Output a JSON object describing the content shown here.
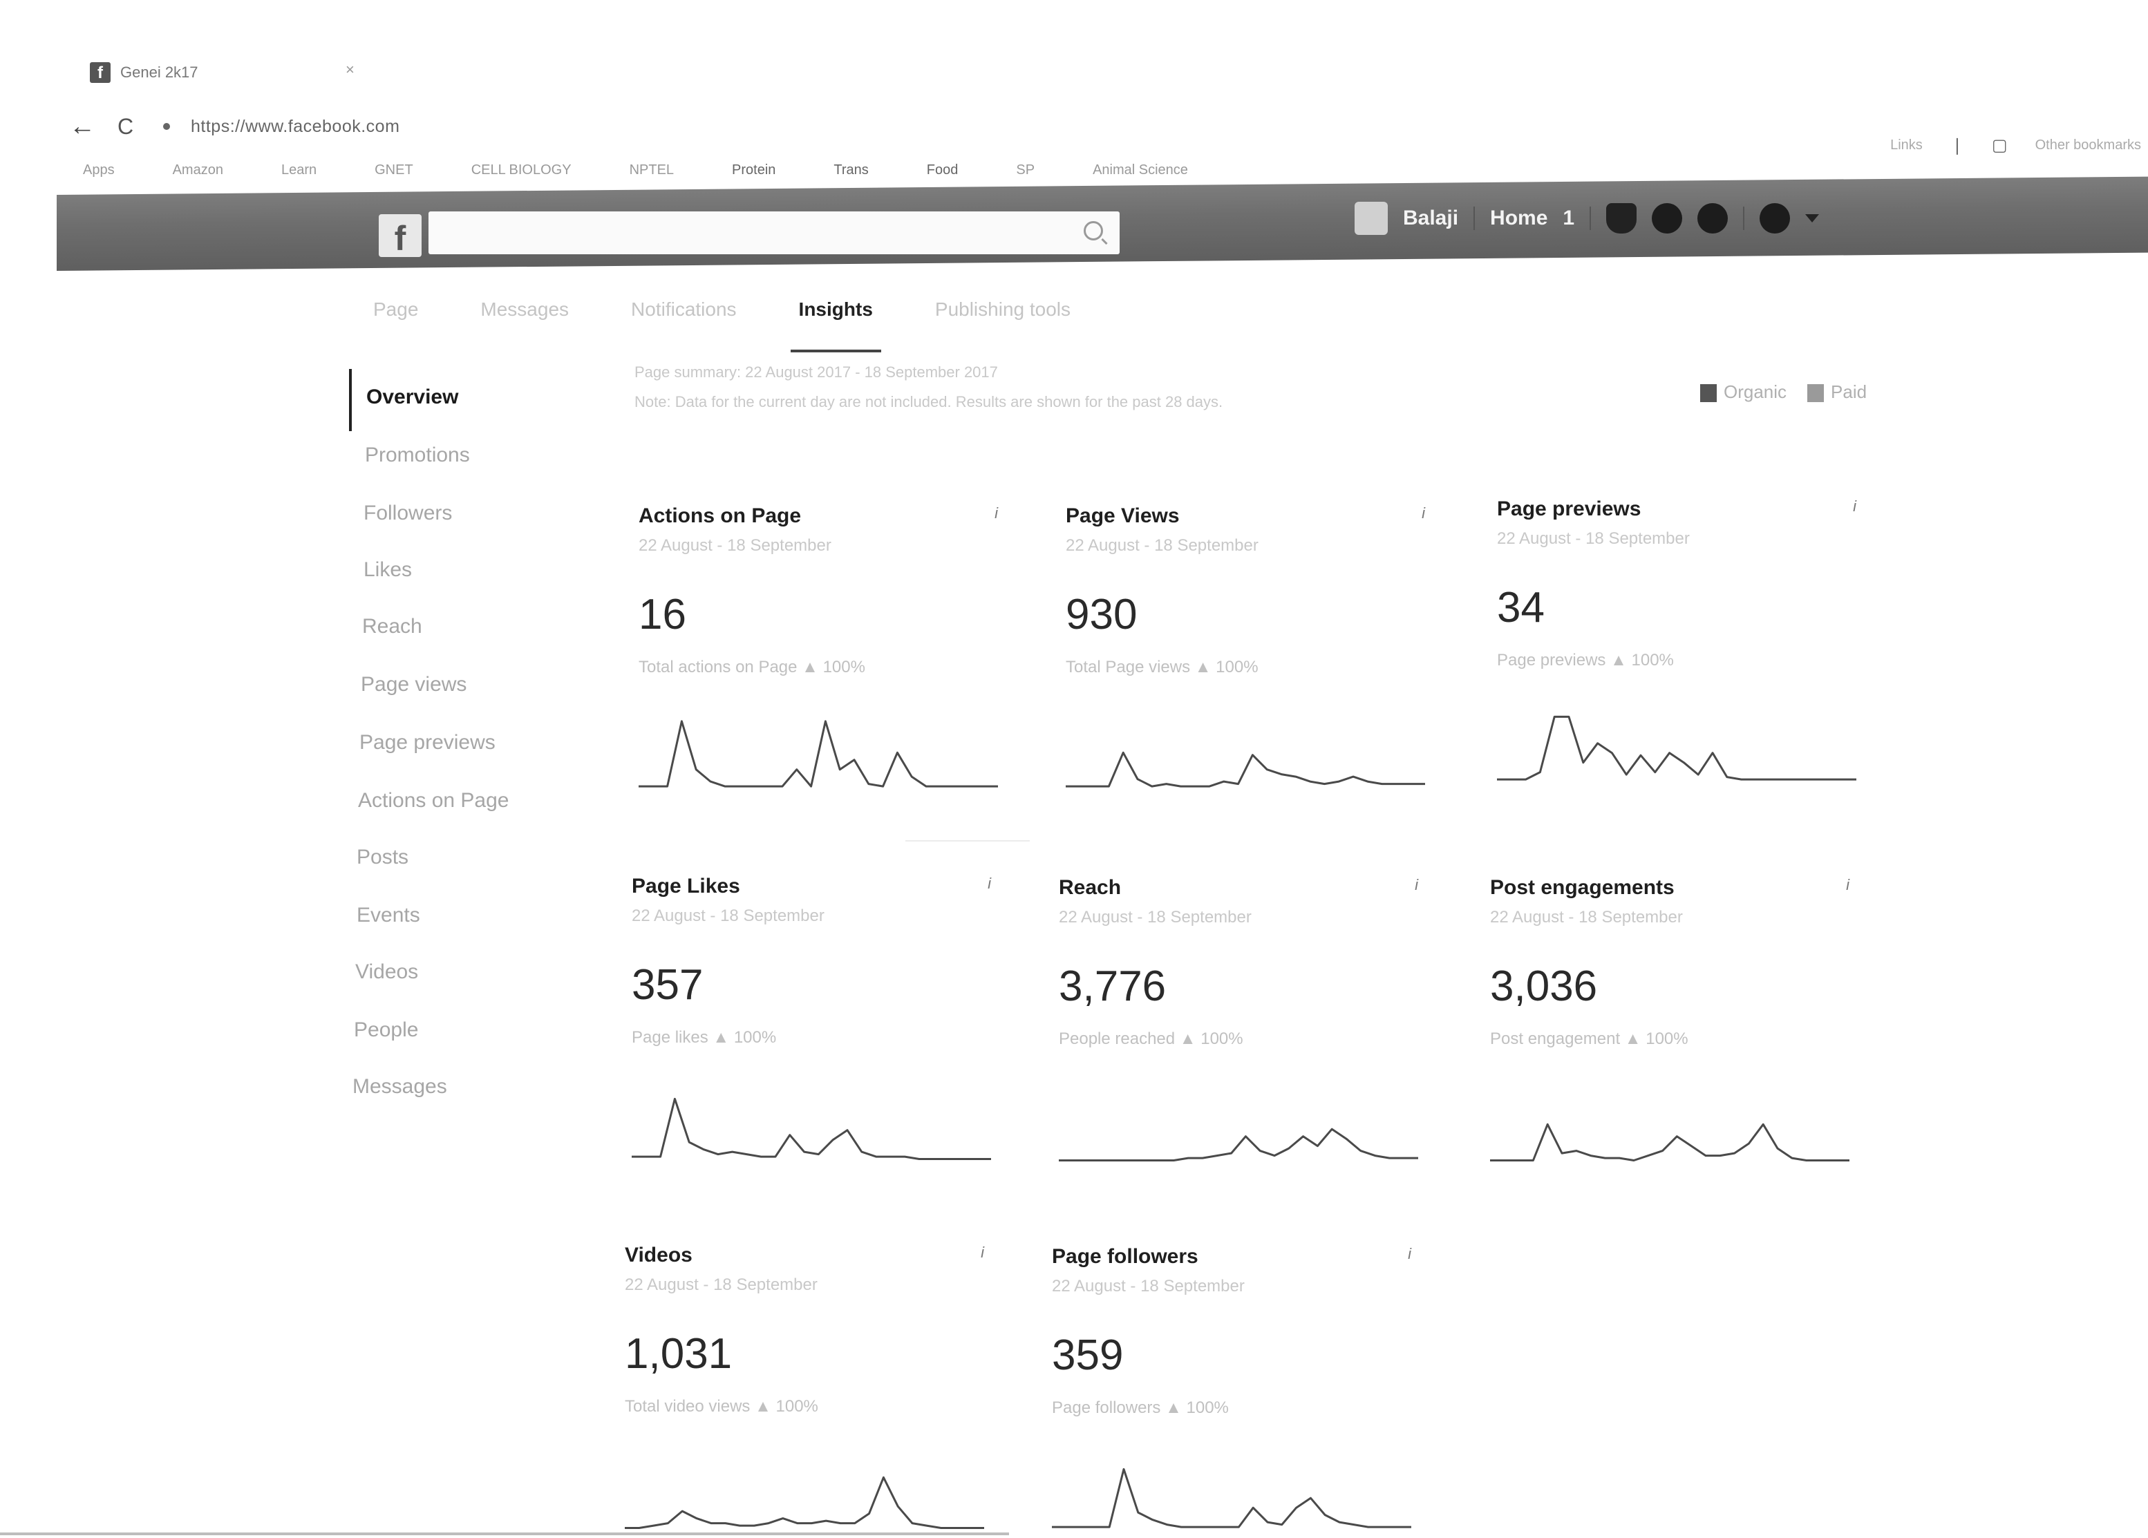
{
  "browser": {
    "tab_title": "Genei 2k17",
    "tab_close": "×",
    "back_arrow": "←",
    "reload_icon": "C",
    "url": "https://www.facebook.com",
    "bookmarks": [
      "Apps",
      "Amazon",
      "Learn",
      "GNET",
      "CELL BIOLOGY",
      "NPTEL",
      "Protein",
      "Trans",
      "Food",
      "SP",
      "Animal Science"
    ],
    "bookmarks_right": [
      "Links",
      "Other bookmarks"
    ]
  },
  "facebook_bar": {
    "logo": "f",
    "search_placeholder": "",
    "user_name": "Balaji",
    "home_label": "Home",
    "home_count": "1"
  },
  "page_tabs": [
    {
      "label": "Page"
    },
    {
      "label": "Messages"
    },
    {
      "label": "Notifications"
    },
    {
      "label": "Insights",
      "active": true
    },
    {
      "label": "Publishing tools"
    }
  ],
  "sidebar": [
    {
      "label": "Overview",
      "active": true
    },
    {
      "label": "Promotions"
    },
    {
      "label": "Followers"
    },
    {
      "label": "Likes"
    },
    {
      "label": "Reach"
    },
    {
      "label": "Page views"
    },
    {
      "label": "Page previews"
    },
    {
      "label": "Actions on Page"
    },
    {
      "label": "Posts"
    },
    {
      "label": "Events"
    },
    {
      "label": "Videos"
    },
    {
      "label": "People"
    },
    {
      "label": "Messages"
    }
  ],
  "header": {
    "date_line": "Page summary: 22 August 2017 - 18 September 2017",
    "description": "Note: Data for the current day are not included. Results are shown for the past 28 days.",
    "legend": [
      {
        "label": "Organic",
        "color": "#555555"
      },
      {
        "label": "Paid",
        "color": "#9a9a9a"
      }
    ]
  },
  "cards": [
    {
      "title": "Actions on Page",
      "range": "22 August - 18 September",
      "value": "16",
      "caption": "Total actions on Page ▲ 100%",
      "info": "i",
      "spark": [
        8,
        8,
        8,
        62,
        22,
        12,
        8,
        8,
        8,
        8,
        8,
        22,
        8,
        62,
        22,
        30,
        10,
        8,
        36,
        16,
        8,
        8,
        8,
        8,
        8,
        8
      ]
    },
    {
      "title": "Page Views",
      "range": "22 August - 18 September",
      "value": "930",
      "caption": "Total Page views ▲ 100%",
      "info": "i",
      "spark": [
        8,
        8,
        8,
        8,
        36,
        14,
        8,
        10,
        8,
        8,
        8,
        12,
        10,
        34,
        22,
        18,
        16,
        12,
        10,
        12,
        16,
        12,
        10,
        10,
        10,
        10
      ]
    },
    {
      "title": "Page previews",
      "range": "22 August - 18 September",
      "value": "34",
      "caption": "Page previews ▲ 100%",
      "info": "i",
      "spark": [
        8,
        8,
        8,
        14,
        60,
        60,
        22,
        38,
        30,
        12,
        28,
        14,
        30,
        22,
        12,
        30,
        10,
        8,
        8,
        8,
        8,
        8,
        8,
        8,
        8,
        8
      ]
    },
    {
      "title": "Page Likes",
      "range": "22 August - 18 September",
      "value": "357",
      "caption": "Page likes ▲ 100%",
      "info": "i",
      "spark": [
        8,
        8,
        8,
        56,
        20,
        14,
        10,
        12,
        10,
        8,
        8,
        26,
        12,
        10,
        22,
        30,
        12,
        8,
        8,
        8,
        6,
        6,
        6,
        6,
        6,
        6
      ]
    },
    {
      "title": "Reach",
      "range": "22 August - 18 September",
      "value": "3,776",
      "caption": "People reached ▲ 100%",
      "info": "i",
      "spark": [
        6,
        6,
        6,
        6,
        6,
        6,
        6,
        6,
        6,
        8,
        8,
        10,
        12,
        26,
        14,
        10,
        16,
        26,
        18,
        32,
        24,
        14,
        10,
        8,
        8,
        8
      ]
    },
    {
      "title": "Post engagements",
      "range": "22 August - 18 September",
      "value": "3,036",
      "caption": "Post engagement ▲ 100%",
      "info": "i",
      "spark": [
        6,
        6,
        6,
        6,
        36,
        12,
        14,
        10,
        8,
        8,
        6,
        10,
        14,
        26,
        18,
        10,
        10,
        12,
        20,
        36,
        16,
        8,
        6,
        6,
        6,
        6
      ]
    },
    {
      "title": "Videos",
      "range": "22 August - 18 September",
      "value": "1,031",
      "caption": "Total video views ▲ 100%",
      "info": "i",
      "spark": [
        6,
        6,
        8,
        10,
        20,
        14,
        10,
        10,
        8,
        8,
        10,
        14,
        10,
        10,
        12,
        10,
        10,
        18,
        48,
        24,
        10,
        8,
        6,
        6,
        6,
        6
      ]
    },
    {
      "title": "Page followers",
      "range": "22 August - 18 September",
      "value": "359",
      "caption": "Page followers ▲ 100%",
      "info": "i",
      "spark": [
        8,
        8,
        8,
        8,
        8,
        56,
        20,
        14,
        10,
        8,
        8,
        8,
        8,
        8,
        24,
        12,
        10,
        24,
        32,
        18,
        12,
        10,
        8,
        8,
        8,
        8
      ]
    }
  ]
}
